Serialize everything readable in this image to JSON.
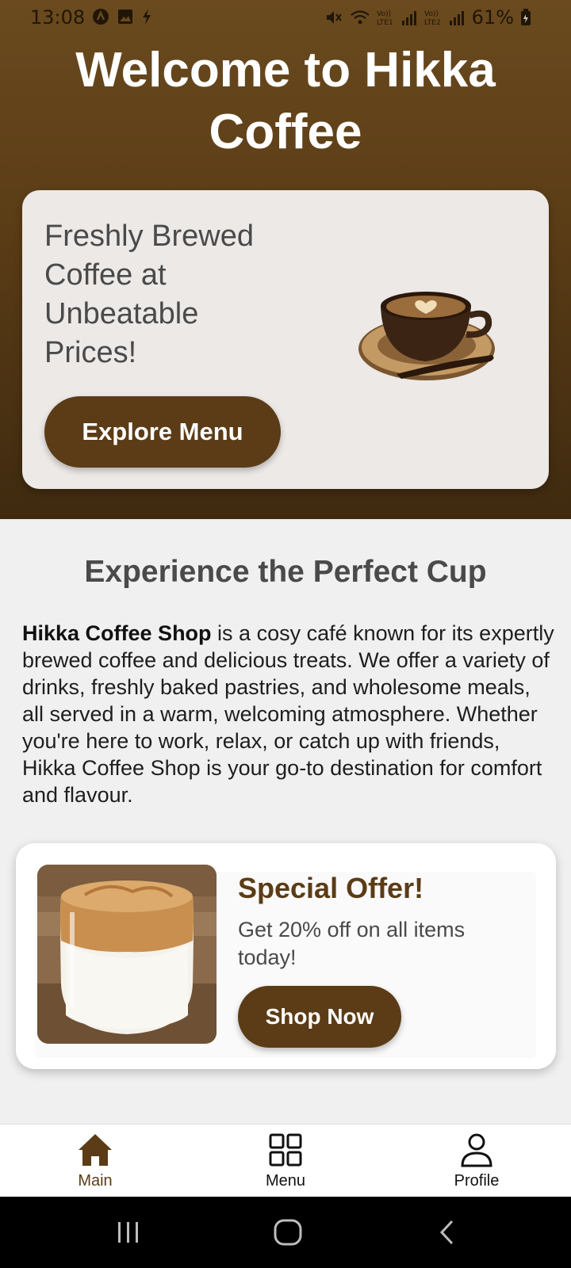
{
  "status_bar": {
    "time": "13:08",
    "battery": "61%",
    "network_labels": [
      "Vo)) LTE1",
      "Vo)) LTE2"
    ]
  },
  "hero": {
    "title": "Welcome to Hikka Coffee",
    "card_text": "Freshly Brewed Coffee at Unbeatable Prices!",
    "explore_button": "Explore Menu"
  },
  "about": {
    "title": "Experience the Perfect Cup",
    "brand": "Hikka Coffee Shop",
    "text": " is a cosy café known for its expertly brewed coffee and delicious treats. We offer a variety of drinks, freshly baked pastries, and wholesome meals, all served in a warm, welcoming atmosphere. Whether you're here to work, relax, or catch up with friends, Hikka Coffee Shop is your go-to destination for comfort and flavour."
  },
  "offer": {
    "title": "Special Offer!",
    "subtitle": "Get 20% off on all items today!",
    "button": "Shop Now"
  },
  "bottom_nav": {
    "items": [
      {
        "label": "Main",
        "icon": "home-icon",
        "active": true
      },
      {
        "label": "Menu",
        "icon": "grid-icon",
        "active": false
      },
      {
        "label": "Profile",
        "icon": "person-icon",
        "active": false
      }
    ]
  },
  "colors": {
    "brand_brown": "#5b3c16",
    "hero_gradient_top": "#6a4a1e",
    "hero_gradient_bottom": "#3f2a10",
    "background": "#f0f0f0"
  }
}
